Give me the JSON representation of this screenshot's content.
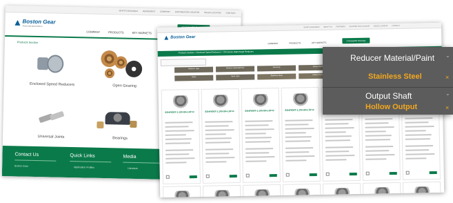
{
  "back_site": {
    "utility_links": [
      "WHAT'S AVAILABLE",
      "REPRESENT",
      "COMPANY",
      "DISTRIBUTOR LOCATOR",
      "SALES LOCATOR",
      "CONTACT"
    ],
    "brand": "Boston Gear",
    "brand_sub": "Altra Industrial Motion",
    "nav": [
      "COMPANY",
      "PRODUCTS",
      "KEY MARKETS"
    ],
    "catalog_button": "eCatalog/3D Drawings",
    "section_label": "Products Section",
    "products": [
      "Enclosed Speed Reducers",
      "Open Gearing",
      "Universal Joints",
      "Bearings"
    ],
    "footer": {
      "col1": "Contact Us",
      "col2": "Quick Links",
      "col3": "Media",
      "col1_item": "Boston Gear",
      "col2_item": "Application Profiles",
      "col3_item": "Literature"
    }
  },
  "front_site": {
    "utility_links": [
      "WHAT'S AVAILABLE",
      "ABOUT US",
      "PARTNERS",
      "DISTRIBUTOR LOCATOR",
      "SALES LOCATOR",
      "CONTACT"
    ],
    "brand": "Boston Gear",
    "nav": [
      "COMPANY",
      "PRODUCTS",
      "KEY MARKETS"
    ],
    "catalog_button": "eCatalog/3D Drawings",
    "breadcrumb": "Products Section > Enclosed Speed Reducers > 700 Series Right Angle Reducers",
    "filter_chips": [
      "Reducer Type",
      "Reducer Material/Paint",
      "Mounting",
      "Output Shaft",
      "Ratio",
      "Input Type",
      "Stainless Steel",
      "Hollow Output"
    ],
    "cards": [
      {
        "title": "SSHF600T-1:100-SN-LSP-N"
      },
      {
        "title": "SSHF600T-1:100-SN-LSP-N"
      },
      {
        "title": "SSHF600T-1:100-SN-LSP-N"
      },
      {
        "title": "SSHF600T-1:100-SN-LSP-N"
      },
      {
        "title": "SSHF600T-1:100-SN-LSP-N"
      },
      {
        "title": "SSHF600T-1:100-SN-LSP-N"
      },
      {
        "title": "SSHF600T-1:100-SN-LSP-N"
      }
    ]
  },
  "callout": {
    "label1": "Reducer Material/Paint",
    "value1": "Stainless Steel",
    "label2": "Output Shaft",
    "value2": "Hollow Output",
    "remove_icon": "×",
    "expand_icon": "⌄"
  }
}
